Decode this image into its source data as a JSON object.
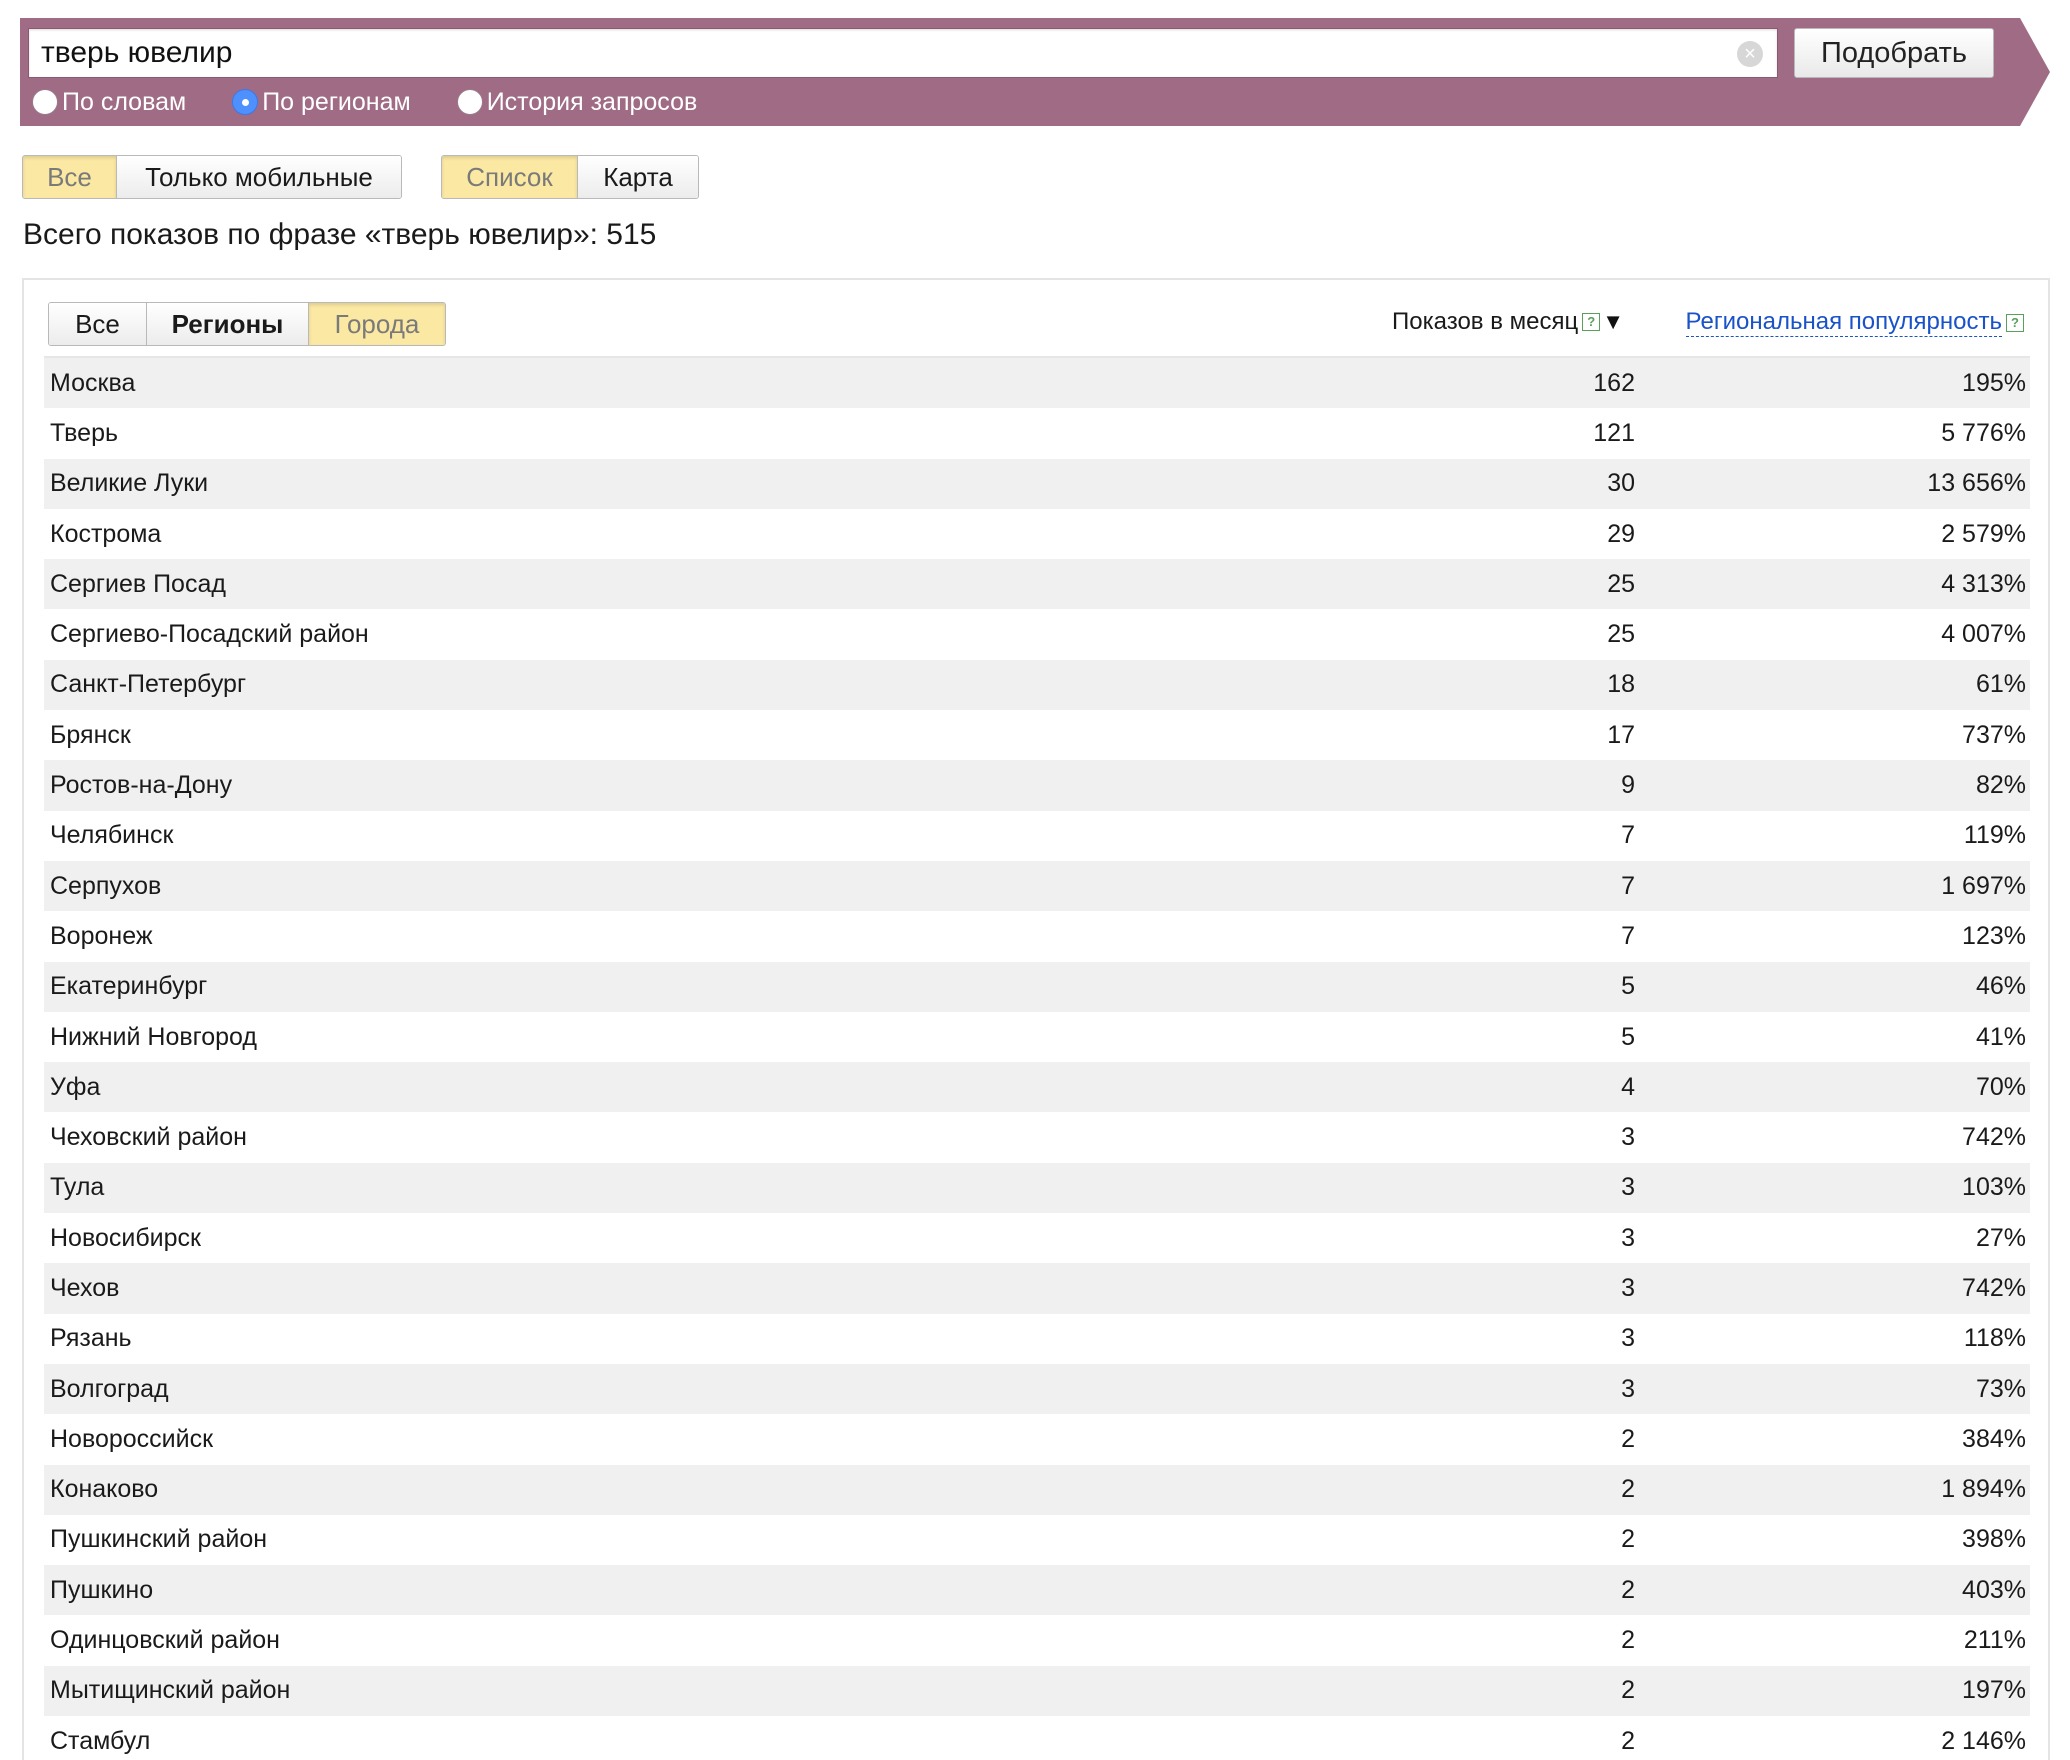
{
  "search": {
    "query": "тверь ювелир",
    "clear_icon": "×",
    "button_label": "Подобрать",
    "modes": [
      {
        "label": "По словам",
        "checked": false
      },
      {
        "label": "По регионам",
        "checked": true
      },
      {
        "label": "История запросов",
        "checked": false
      }
    ]
  },
  "device_filter": {
    "all": "Все",
    "mobile": "Только мобильные",
    "active": "all"
  },
  "view_filter": {
    "list": "Список",
    "map": "Карта",
    "active": "list"
  },
  "total_line": "Всего показов по фразе «тверь ювелир»: 515",
  "region_tabs": {
    "all": "Все",
    "regions": "Регионы",
    "cities": "Города",
    "active": "cities"
  },
  "columns": {
    "count": "Показов в месяц",
    "help": "?",
    "sort_arrow": "▼",
    "popularity": "Региональная популярность"
  },
  "colors": {
    "banner": "#a06b85",
    "active_tab": "#fbe8a3",
    "link": "#1a52c8"
  },
  "rows": [
    {
      "name": "Москва",
      "count": "162",
      "pop": "195%"
    },
    {
      "name": "Тверь",
      "count": "121",
      "pop": "5 776%"
    },
    {
      "name": "Великие Луки",
      "count": "30",
      "pop": "13 656%"
    },
    {
      "name": "Кострома",
      "count": "29",
      "pop": "2 579%"
    },
    {
      "name": "Сергиев Посад",
      "count": "25",
      "pop": "4 313%"
    },
    {
      "name": "Сергиево-Посадский район",
      "count": "25",
      "pop": "4 007%"
    },
    {
      "name": "Санкт-Петербург",
      "count": "18",
      "pop": "61%"
    },
    {
      "name": "Брянск",
      "count": "17",
      "pop": "737%"
    },
    {
      "name": "Ростов-на-Дону",
      "count": "9",
      "pop": "82%"
    },
    {
      "name": "Челябинск",
      "count": "7",
      "pop": "119%"
    },
    {
      "name": "Серпухов",
      "count": "7",
      "pop": "1 697%"
    },
    {
      "name": "Воронеж",
      "count": "7",
      "pop": "123%"
    },
    {
      "name": "Екатеринбург",
      "count": "5",
      "pop": "46%"
    },
    {
      "name": "Нижний Новгород",
      "count": "5",
      "pop": "41%"
    },
    {
      "name": "Уфа",
      "count": "4",
      "pop": "70%"
    },
    {
      "name": "Чеховский район",
      "count": "3",
      "pop": "742%"
    },
    {
      "name": "Тула",
      "count": "3",
      "pop": "103%"
    },
    {
      "name": "Новосибирск",
      "count": "3",
      "pop": "27%"
    },
    {
      "name": "Чехов",
      "count": "3",
      "pop": "742%"
    },
    {
      "name": "Рязань",
      "count": "3",
      "pop": "118%"
    },
    {
      "name": "Волгоград",
      "count": "3",
      "pop": "73%"
    },
    {
      "name": "Новороссийск",
      "count": "2",
      "pop": "384%"
    },
    {
      "name": "Конаково",
      "count": "2",
      "pop": "1 894%"
    },
    {
      "name": "Пушкинский район",
      "count": "2",
      "pop": "398%"
    },
    {
      "name": "Пушкино",
      "count": "2",
      "pop": "403%"
    },
    {
      "name": "Одинцовский район",
      "count": "2",
      "pop": "211%"
    },
    {
      "name": "Мытищинский район",
      "count": "2",
      "pop": "197%"
    },
    {
      "name": "Стамбул",
      "count": "2",
      "pop": "2 146%"
    }
  ]
}
